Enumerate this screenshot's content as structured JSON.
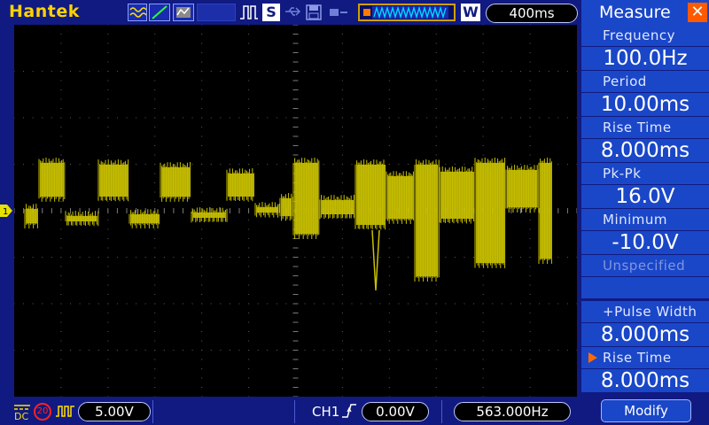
{
  "header": {
    "brand": "Hantek",
    "run_state_badge": "S",
    "window_badge": "W",
    "timebase": "400ms"
  },
  "colors": {
    "background": "#101a80",
    "screen": "#000000",
    "trace": "#c8c000",
    "panel": "#1a47c8",
    "brand": "#ffd200",
    "accent": "#ff5a00"
  },
  "channel": {
    "marker_label": "1"
  },
  "footer": {
    "coupling": "DC",
    "bandwidth_limit": "20",
    "volts_div": "5.00V",
    "trigger_channel": "CH1",
    "trigger_level": "0.00V",
    "frequency": "563.000Hz"
  },
  "measure_panel": {
    "title": "Measure",
    "rows": [
      {
        "label": "Frequency",
        "value": "100.0Hz"
      },
      {
        "label": "Period",
        "value": "10.00ms"
      },
      {
        "label": "Rise Time",
        "value": "8.000ms"
      },
      {
        "label": "Pk-Pk",
        "value": "16.0V"
      },
      {
        "label": "Minimum",
        "value": "-10.0V"
      },
      {
        "label": "Unspecified",
        "value": ""
      },
      {
        "label": "+Pulse Width",
        "value": "8.000ms"
      },
      {
        "label": "Rise Time",
        "value": "8.000ms"
      }
    ],
    "modify_label": "Modify"
  },
  "icons": [
    "waveform-mode-icon",
    "line-display-icon",
    "persistence-icon",
    "trigger-pulse-icon",
    "usb-icon",
    "save-icon",
    "stop-icon",
    "buffer-waveform-icon",
    "close-icon",
    "ch1-marker-icon",
    "dc-coupling-icon",
    "bandwidth-limit-icon",
    "trigger-edge-icon",
    "selected-arrow-icon"
  ]
}
